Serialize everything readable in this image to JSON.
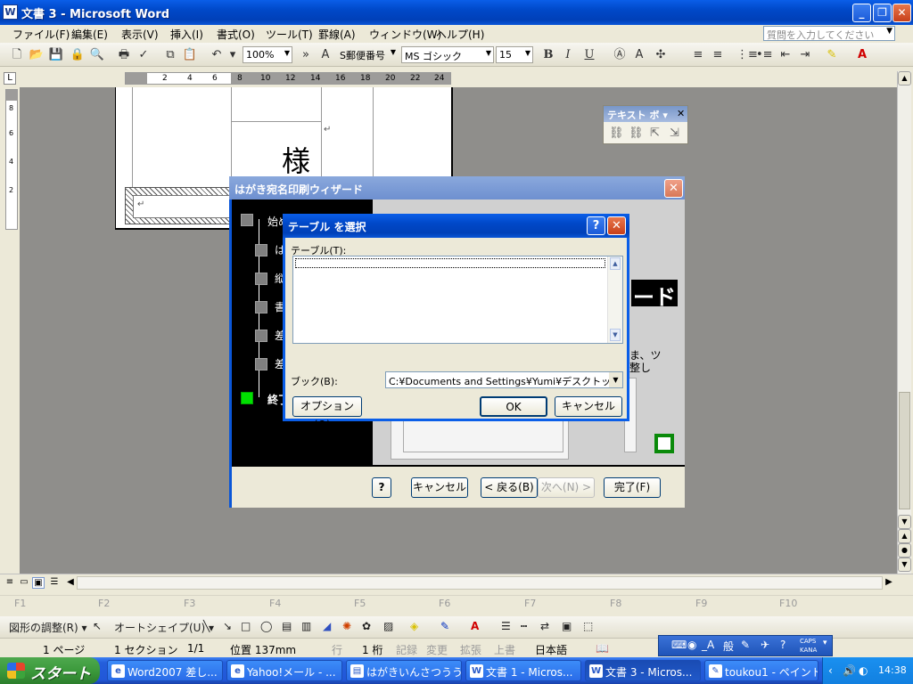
{
  "window": {
    "title": "文書 3 - Microsoft Word",
    "app_icon": "W"
  },
  "menu": [
    "ファイル(F)",
    "編集(E)",
    "表示(V)",
    "挿入(I)",
    "書式(O)",
    "ツール(T)",
    "罫線(A)",
    "ウィンドウ(W)",
    "ヘルプ(H)"
  ],
  "help_box": {
    "placeholder": "質問を入力してください"
  },
  "toolbar": {
    "zoom": "100%",
    "style": "S郵便番号",
    "font": "MS ゴシック",
    "size": "15",
    "bold": "B",
    "italic": "I",
    "underline": "U"
  },
  "ruler": {
    "numbers": [
      "2",
      "4",
      "6",
      "8",
      "10",
      "12",
      "14",
      "16",
      "18",
      "20",
      "22",
      "24"
    ],
    "vertical": [
      "8",
      "6",
      "4",
      "2"
    ]
  },
  "document": {
    "sama": "様",
    "para": "↵"
  },
  "textbox_toolbar": {
    "title": "テキスト ボ",
    "close": "✕"
  },
  "wizard": {
    "title": "はがき宛名印刷ウィザード",
    "steps": [
      "始め",
      "は す",
      "縦 し",
      "書",
      "差 し",
      "差 し",
      "終了"
    ],
    "banner": "ード",
    "note_line1": "ま、ツ",
    "note_line2": "整し",
    "help_btn": "?",
    "cancel": "キャンセル",
    "back": "< 戻る(B)",
    "next": "次へ(N) >",
    "finish": "完了(F)"
  },
  "select_table": {
    "title": "テーブル を選択",
    "table_label": "テーブル(T):",
    "book_label": "ブック(B):",
    "book_value": "C:¥Documents and Settings¥Yumi¥デスクトップ¥葉",
    "options": "オプション(O)...",
    "ok": "OK",
    "cancel": "キャンセル"
  },
  "fkeys": [
    "F1",
    "F2",
    "F3",
    "F4",
    "F5",
    "F6",
    "F7",
    "F8",
    "F9",
    "F10"
  ],
  "draw": {
    "adjust": "図形の調整(R)",
    "autoshape": "オートシェイプ(U)"
  },
  "status": {
    "page": "1 ページ",
    "section": "1 セクション",
    "pages": "1/1",
    "position": "位置 137mm",
    "line": "行",
    "col": "1 桁",
    "rec": "記録",
    "trk": "変更",
    "ext": "拡張",
    "ovr": "上書",
    "lang": "日本語"
  },
  "ime": {
    "mode": "_A",
    "general": "般",
    "caps": "CAPS",
    "kana": "KANA"
  },
  "taskbar": {
    "start": "スタート",
    "tasks": [
      "Word2007 差し...",
      "Yahoo!メール - ...",
      "はがきいんさつうう...",
      "文書 1 - Micros...",
      "文書 3 - Micros...",
      "toukou1 - ペイント"
    ],
    "clock": "14:38"
  }
}
